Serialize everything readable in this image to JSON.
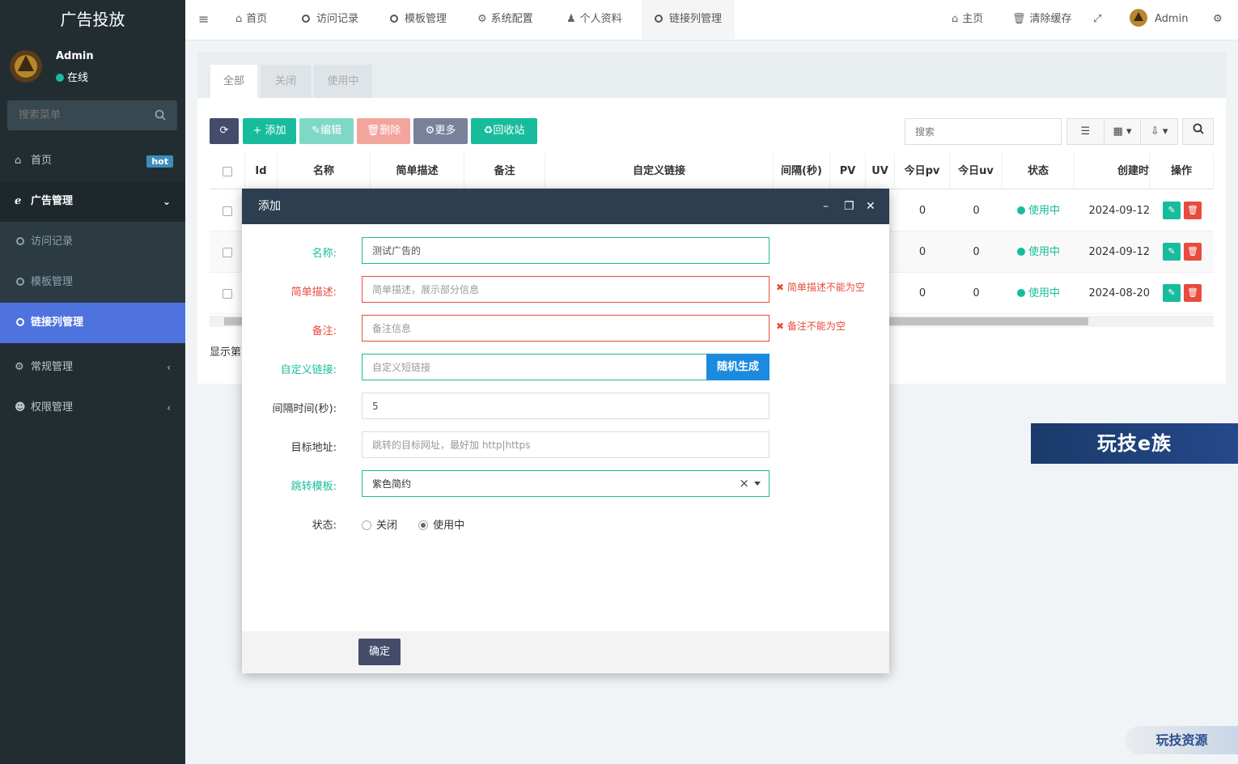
{
  "sidebar": {
    "brand": "广告投放",
    "user_name": "Admin",
    "user_status": "在线",
    "search_placeholder": "搜索菜单",
    "items": [
      {
        "label": "首页",
        "badge": "hot"
      },
      {
        "label": "广告管理"
      },
      {
        "label": "访问记录"
      },
      {
        "label": "模板管理"
      },
      {
        "label": "链接列管理"
      },
      {
        "label": "常规管理"
      },
      {
        "label": "权限管理"
      }
    ]
  },
  "topnav": {
    "tabs": [
      "首页",
      "访问记录",
      "模板管理",
      "系统配置",
      "个人资料",
      "链接列管理"
    ],
    "right": {
      "home": "主页",
      "clear_cache": "清除缓存",
      "user": "Admin"
    }
  },
  "content": {
    "tabs": [
      "全部",
      "关闭",
      "使用中"
    ],
    "toolbar": {
      "add": "添加",
      "edit": "编辑",
      "delete": "删除",
      "more": "更多",
      "recycle": "回收站"
    },
    "search_placeholder": "搜索",
    "table": {
      "headers": [
        "Id",
        "名称",
        "简单描述",
        "备注",
        "自定义链接",
        "间隔(秒)",
        "PV",
        "UV",
        "今日pv",
        "今日uv",
        "状态",
        "创建时",
        "操作"
      ],
      "rows": [
        {
          "today_pv": "0",
          "today_uv": "0",
          "status": "使用中",
          "created": "2024-09-12"
        },
        {
          "today_pv": "0",
          "today_uv": "0",
          "status": "使用中",
          "created": "2024-09-12"
        },
        {
          "today_pv": "0",
          "today_uv": "0",
          "status": "使用中",
          "created": "2024-08-20"
        }
      ]
    },
    "page_info": "显示第"
  },
  "modal": {
    "title": "添加",
    "fields": {
      "name": {
        "label": "名称:",
        "value": "测试广告的"
      },
      "desc": {
        "label": "简单描述:",
        "placeholder": "简单描述，展示部分信息",
        "error": "简单描述不能为空"
      },
      "remark": {
        "label": "备注:",
        "placeholder": "备注信息",
        "error": "备注不能为空"
      },
      "custom_link": {
        "label": "自定义链接:",
        "placeholder": "自定义短链接",
        "button": "随机生成"
      },
      "interval": {
        "label": "间隔时间(秒):",
        "value": "5"
      },
      "target": {
        "label": "目标地址:",
        "placeholder": "跳转的目标网址，最好加 http|https"
      },
      "template": {
        "label": "跳转模板:",
        "value": "紫色简约"
      },
      "status": {
        "label": "状态:",
        "options": [
          "关闭",
          "使用中"
        ],
        "selected": "使用中"
      }
    },
    "confirm": "确定"
  },
  "watermarks": [
    "玩技e族",
    "玩技资源"
  ],
  "colors": {
    "sidebar": "#222d32",
    "active": "#4e73df",
    "success": "#18bc9c",
    "danger": "#e74c3c",
    "modal_head": "#2c3e50"
  }
}
